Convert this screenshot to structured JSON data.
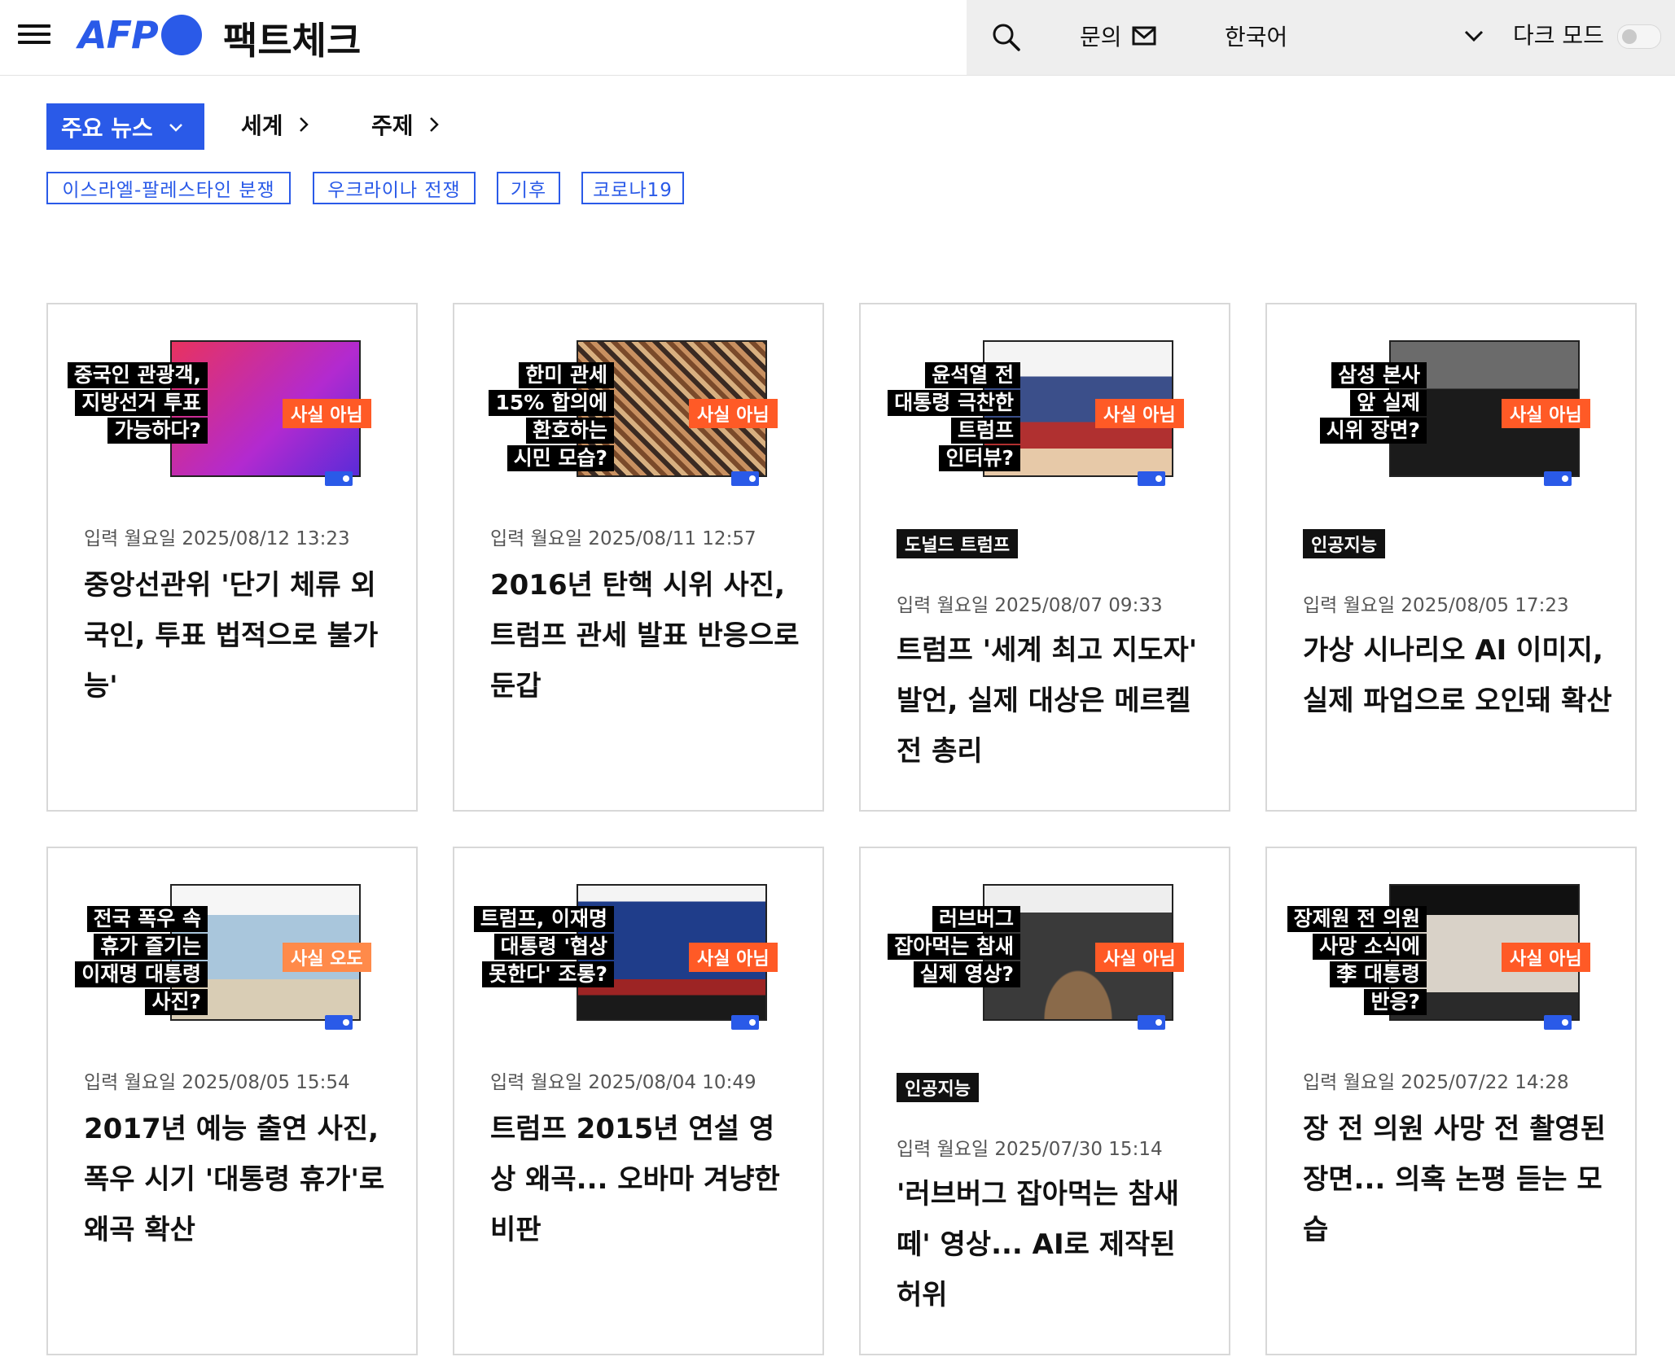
{
  "header": {
    "logo_text": "AFP",
    "site_title": "팩트체크",
    "contact_label": "문의",
    "language": "한국어",
    "dark_mode_label": "다크 모드"
  },
  "nav": {
    "main_label": "주요 뉴스",
    "links": [
      "세계",
      "주제"
    ],
    "topics": [
      "이스라엘-팔레스타인 분쟁",
      "우크라이나 전쟁",
      "기후",
      "코로나19"
    ]
  },
  "colors": {
    "accent": "#2a5ae8",
    "verdict": "#ff5a26",
    "category": "#111111"
  },
  "articles": [
    {
      "thumb_lines": [
        "중국인 관광객,",
        "지방선거 투표",
        "가능하다?"
      ],
      "verdict": "사실 아님",
      "category": "",
      "date": "입력 월요일 2025/08/12 13:23",
      "title": "중앙선관위 '단기 체류 외국인, 투표 법적으로 불가능'"
    },
    {
      "thumb_lines": [
        "한미 관세",
        "15% 합의에",
        "환호하는",
        "시민 모습?"
      ],
      "verdict": "사실 아님",
      "category": "",
      "date": "입력 월요일 2025/08/11 12:57",
      "title": "2016년 탄핵 시위 사진, 트럼프 관세 발표 반응으로 둔갑"
    },
    {
      "thumb_lines": [
        "윤석열 전",
        "대통령 극찬한",
        "트럼프",
        "인터뷰?"
      ],
      "verdict": "사실 아님",
      "category": "도널드 트럼프",
      "date": "입력 월요일 2025/08/07 09:33",
      "title": "트럼프 '세계 최고 지도자' 발언, 실제 대상은 메르켈 전 총리"
    },
    {
      "thumb_lines": [
        "삼성 본사",
        "앞 실제",
        "시위 장면?"
      ],
      "verdict": "사실 아님",
      "category": "인공지능",
      "date": "입력 월요일 2025/08/05 17:23",
      "title": "가상 시나리오 AI 이미지, 실제 파업으로 오인돼 확산"
    },
    {
      "thumb_lines": [
        "전국 폭우 속",
        "휴가 즐기는",
        "이재명 대통령",
        "사진?"
      ],
      "verdict": "사실 오도",
      "category": "",
      "date": "입력 월요일 2025/08/05 15:54",
      "title": "2017년 예능 출연 사진, 폭우 시기 '대통령 휴가'로 왜곡 확산"
    },
    {
      "thumb_lines": [
        "트럼프, 이재명",
        "대통령 '협상",
        "못한다' 조롱?"
      ],
      "verdict": "사실 아님",
      "category": "",
      "date": "입력 월요일 2025/08/04 10:49",
      "title": "트럼프 2015년 연설 영상 왜곡... 오바마 겨냥한 비판"
    },
    {
      "thumb_lines": [
        "러브버그",
        "잡아먹는 참새",
        "실제 영상?"
      ],
      "verdict": "사실 아님",
      "category": "인공지능",
      "date": "입력 월요일 2025/07/30 15:14",
      "title": "'러브버그 잡아먹는 참새 떼' 영상... AI로 제작된 허위"
    },
    {
      "thumb_lines": [
        "장제원 전 의원",
        "사망 소식에",
        "李 대통령",
        "반응?"
      ],
      "verdict": "사실 아님",
      "category": "",
      "date": "입력 월요일 2025/07/22 14:28",
      "title": "장 전 의원 사망 전 촬영된 장면... 의혹 논평 듣는 모습"
    }
  ]
}
